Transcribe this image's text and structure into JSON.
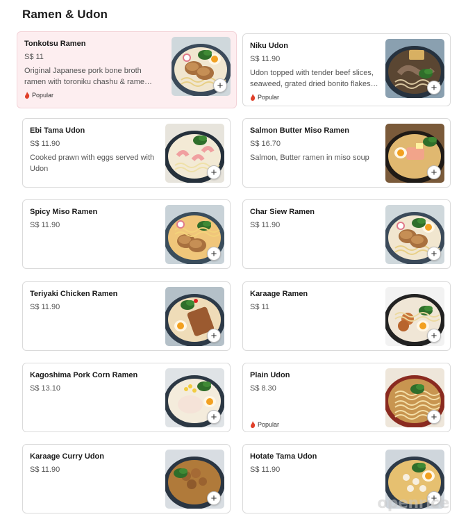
{
  "section": {
    "title": "Ramen & Udon"
  },
  "items": [
    {
      "name": "Tonkotsu Ramen",
      "price": "S$ 11",
      "description": "Original Japanese pork bone broth ramen with toroniku chashu & rame…",
      "badge": "Popular",
      "food": "ramen-chashu-egg"
    },
    {
      "name": "Niku Udon",
      "price": "S$ 11.90",
      "description": "Udon topped with tender beef slices, seaweed, grated dried bonito flakes…",
      "badge": "Popular",
      "food": "udon-beef"
    },
    {
      "name": "Ebi Tama Udon",
      "price": "S$ 11.90",
      "description": "Cooked prawn with eggs served with Udon",
      "food": "udon-prawn"
    },
    {
      "name": "Salmon Butter Miso Ramen",
      "price": "S$ 16.70",
      "description": "Salmon, Butter ramen in miso soup",
      "food": "ramen-salmon"
    },
    {
      "name": "Spicy Miso Ramen",
      "price": "S$ 11.90",
      "food": "ramen-miso"
    },
    {
      "name": "Char Siew Ramen",
      "price": "S$ 11.90",
      "food": "ramen-chashu-egg"
    },
    {
      "name": "Teriyaki Chicken Ramen",
      "price": "S$ 11.90",
      "food": "ramen-teriyaki"
    },
    {
      "name": "Karaage Ramen",
      "price": "S$ 11",
      "food": "ramen-karaage"
    },
    {
      "name": "Kagoshima Pork Corn Ramen",
      "price": "S$ 13.10",
      "food": "ramen-corn"
    },
    {
      "name": "Plain Udon",
      "price": "S$ 8.30",
      "badge": "Popular",
      "food": "udon-plain"
    },
    {
      "name": "Karaage Curry Udon",
      "price": "S$ 11.90",
      "food": "udon-curry"
    },
    {
      "name": "Hotate Tama Udon",
      "price": "S$ 11.90",
      "food": "udon-scallop"
    }
  ],
  "add_button_label": "+",
  "watermark": "openrice",
  "colors": {
    "highlight_bg": "#fdeef0",
    "flame": "#e0402a",
    "border": "#dadada"
  }
}
